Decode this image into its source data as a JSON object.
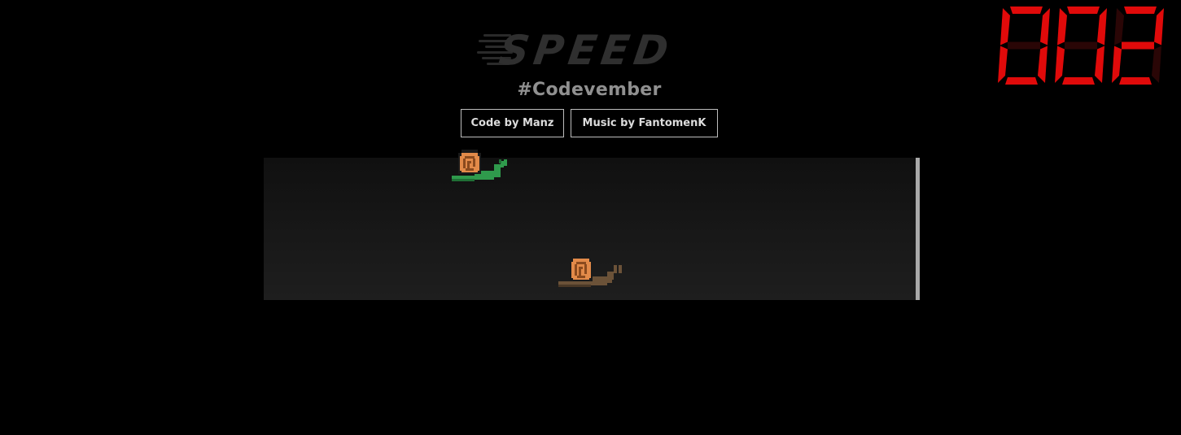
{
  "game": {
    "title": "Speed",
    "subtitle": "#Codevember"
  },
  "credits": {
    "code_label": "Code by Manz",
    "music_label": "Music by FantomenK"
  },
  "counter": {
    "value": "002",
    "digits": [
      "0",
      "0",
      "2"
    ],
    "active_color": "#e00a0a",
    "inactive_color": "#2a0606"
  },
  "track": {
    "background": "#161616",
    "finish_line_color": "#a9a9a9"
  },
  "snails": [
    {
      "name": "green-snail",
      "body_color": "#2f9a4c",
      "shell_color": "#e28a49"
    },
    {
      "name": "brown-snail",
      "body_color": "#6b5238",
      "shell_color": "#e28a49"
    }
  ]
}
